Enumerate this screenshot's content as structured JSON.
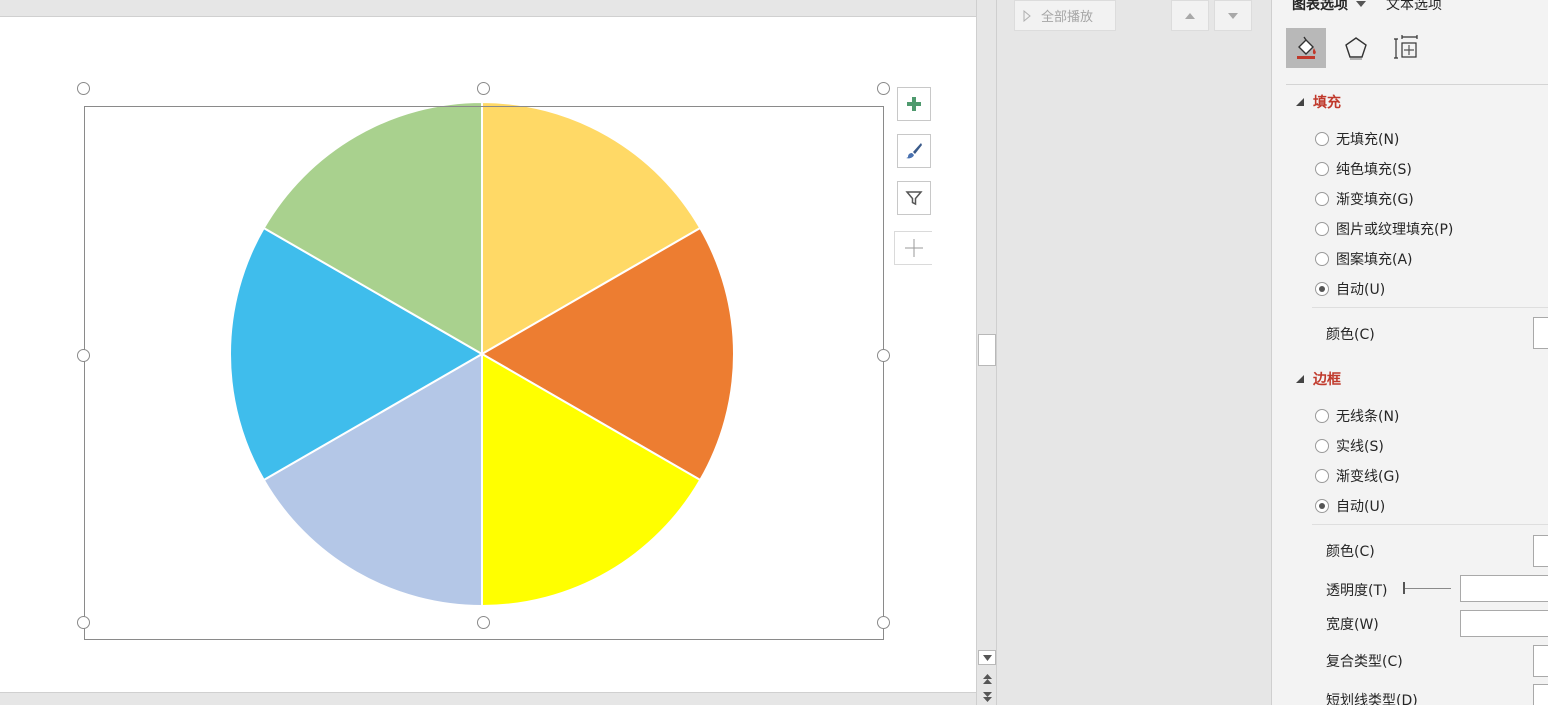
{
  "animation_pane": {
    "play_all_label": "全部播放"
  },
  "format_pane": {
    "tabs": [
      {
        "label": "图表选项"
      },
      {
        "label": "文本选项"
      }
    ],
    "icon_tabs": [
      {
        "icon": "fill-line-icon",
        "active": true
      },
      {
        "icon": "effects-pentagon-icon",
        "active": false
      },
      {
        "icon": "size-properties-icon",
        "active": false
      }
    ],
    "fill": {
      "heading": "填充",
      "options": [
        {
          "label": "无填充(N)",
          "checked": false
        },
        {
          "label": "纯色填充(S)",
          "checked": false
        },
        {
          "label": "渐变填充(G)",
          "checked": false
        },
        {
          "label": "图片或纹理填充(P)",
          "checked": false
        },
        {
          "label": "图案填充(A)",
          "checked": false
        },
        {
          "label": "自动(U)",
          "checked": true
        }
      ],
      "color_label": "颜色(C)"
    },
    "border": {
      "heading": "边框",
      "options": [
        {
          "label": "无线条(N)",
          "checked": false
        },
        {
          "label": "实线(S)",
          "checked": false
        },
        {
          "label": "渐变线(G)",
          "checked": false
        },
        {
          "label": "自动(U)",
          "checked": true
        }
      ],
      "color_label": "颜色(C)",
      "transparency_label": "透明度(T)",
      "width_label": "宽度(W)",
      "compound_type_label": "复合类型(C)",
      "dash_type_label": "短划线类型(D)"
    }
  },
  "chart_data": {
    "type": "pie",
    "values": [
      1,
      1,
      1,
      1,
      1,
      1
    ],
    "colors": [
      "#FFD966",
      "#ED7D31",
      "#FFFF00",
      "#B4C7E7",
      "#3FBDEC",
      "#A9D18E"
    ],
    "slice_border_color": "#FFFFFF",
    "start_angle_deg": 0,
    "title": "",
    "legend": "none"
  },
  "colors": {
    "accent_heading": "#C0392B",
    "selection_frame": "#8A8A8A",
    "active_icon_tab": "#B8B8B8"
  }
}
